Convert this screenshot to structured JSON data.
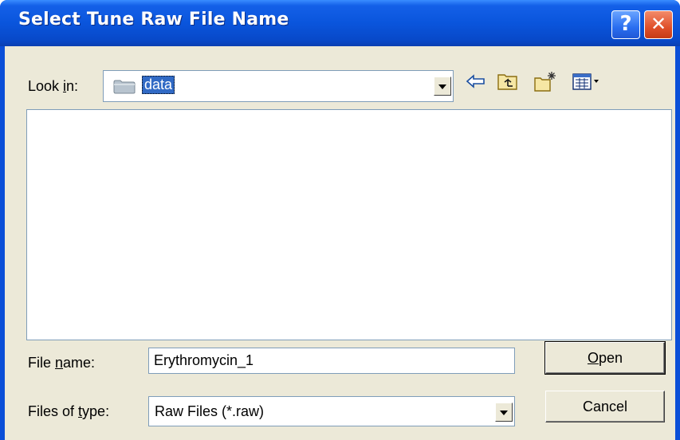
{
  "window": {
    "title": "Select Tune Raw File Name",
    "help_glyph": "?",
    "close_glyph": "✕"
  },
  "lookin": {
    "label_pre": "Look ",
    "label_key": "i",
    "label_post": "n:",
    "value": "data",
    "icon": "folder-icon"
  },
  "toolbar": {
    "back_icon": "back-arrow-icon",
    "up_icon": "up-one-level-icon",
    "new_folder_icon": "new-folder-icon",
    "view_menu_icon": "view-menu-icon"
  },
  "filename": {
    "label_pre": "File ",
    "label_key": "n",
    "label_post": "ame:",
    "value": "Erythromycin_1"
  },
  "filetype": {
    "label_pre": "Files of ",
    "label_key": "t",
    "label_post": "ype:",
    "value": "Raw Files (*.raw)"
  },
  "buttons": {
    "open_key": "O",
    "open_rest": "pen",
    "cancel": "Cancel"
  },
  "colors": {
    "title_bar": "#0a55dc",
    "dialog_face": "#ece9d8",
    "selection": "#316ac5"
  }
}
